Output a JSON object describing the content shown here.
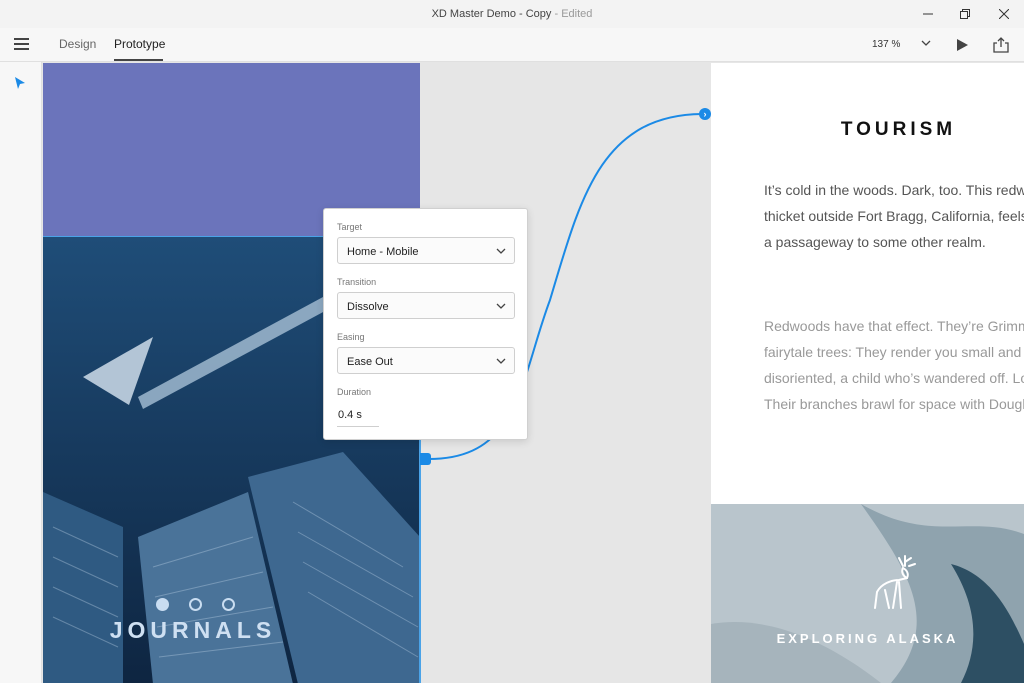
{
  "window": {
    "title": "XD Master Demo - Copy",
    "status": "Edited",
    "separator": " - "
  },
  "toolbar": {
    "tabs": [
      {
        "label": "Design"
      },
      {
        "label": "Prototype"
      }
    ],
    "zoom": "137 %"
  },
  "artboards": {
    "journals": {
      "heading": "JOURNALS"
    },
    "tourism": {
      "heading": "TOURISM",
      "paragraph1": "It’s cold in the woods. Dark, too. This redwood thicket outside Fort Bragg, California, feels like a passageway to some other realm.",
      "paragraph2": "Redwoods have that effect. They’re Grimms’ fairytale trees: They render you small and disoriented, a child who’s wandered off. Look up: Their branches brawl for space with Douglas firs.",
      "banner_label": "EXPLORING ALASKA"
    }
  },
  "prototype_panel": {
    "target": {
      "label": "Target",
      "value": "Home - Mobile"
    },
    "transition": {
      "label": "Transition",
      "value": "Dissolve"
    },
    "easing": {
      "label": "Easing",
      "value": "Ease Out"
    },
    "duration": {
      "label": "Duration",
      "value": "0.4 s"
    }
  },
  "colors": {
    "accent": "#1b8ae6",
    "purple_block": "#6b74bb",
    "photo_tint": "#173658"
  },
  "icons": [
    "hamburger-icon",
    "select-tool-icon",
    "play-icon",
    "share-icon",
    "minimize-icon",
    "restore-icon",
    "close-icon",
    "chevron-down-icon",
    "deer-icon"
  ]
}
